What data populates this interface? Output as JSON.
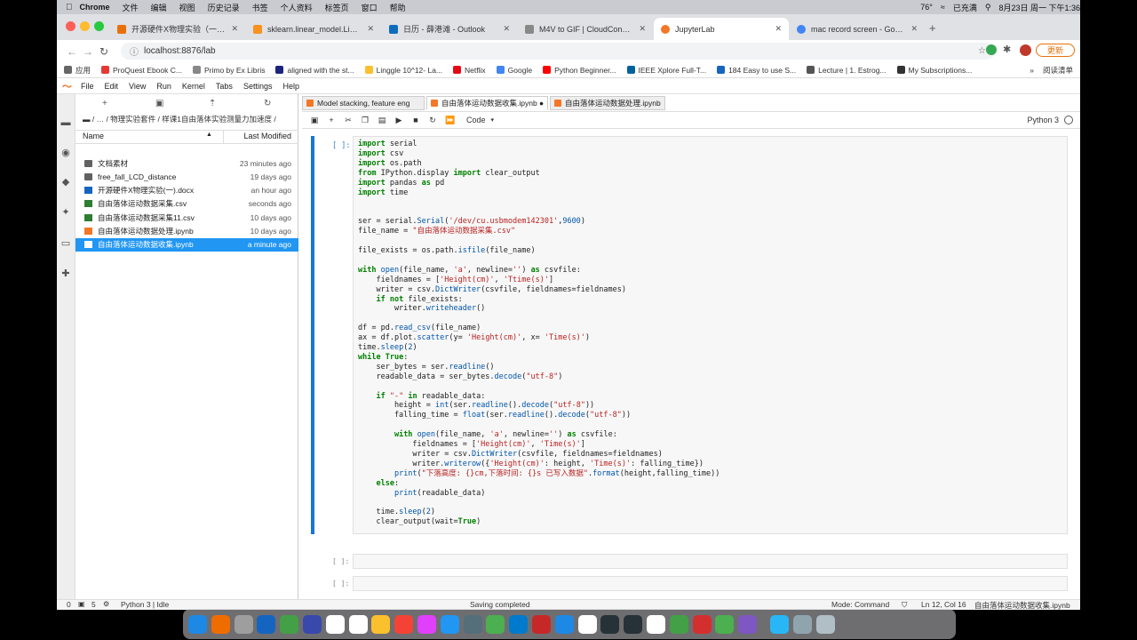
{
  "menubar": {
    "app": "Chrome",
    "items": [
      "文件",
      "编辑",
      "视图",
      "历史记录",
      "书签",
      "个人资料",
      "标签页",
      "窗口",
      "帮助"
    ],
    "status": [
      "76°",
      "已充满",
      "8月23日 周一 下午1:36"
    ]
  },
  "tabs": [
    {
      "title": "开源硬件X物理实验（一）- 自由",
      "color": "#e8710a"
    },
    {
      "title": "sklearn.linear_model.LinearRe",
      "color": "#f7931e"
    },
    {
      "title": "日历 - 薛港滩 - Outlook",
      "color": "#0f6cbd"
    },
    {
      "title": "M4V to GIF | CloudConvert",
      "color": "#888888"
    },
    {
      "title": "JupyterLab",
      "color": "#f37726"
    },
    {
      "title": "mac record screen - Google 搜",
      "color": "#4285f4"
    }
  ],
  "address": {
    "url": "localhost:8876/lab",
    "update_label": "更新"
  },
  "bookmarks": [
    {
      "label": "应用",
      "color": "#666666"
    },
    {
      "label": "ProQuest Ebook C...",
      "color": "#e53935"
    },
    {
      "label": "Primo by Ex Libris",
      "color": "#888888"
    },
    {
      "label": "aligned with the st...",
      "color": "#1a237e"
    },
    {
      "label": "Linggle 10^12- La...",
      "color": "#fbc02d"
    },
    {
      "label": "Netflix",
      "color": "#e50914"
    },
    {
      "label": "Google",
      "color": "#4285f4"
    },
    {
      "label": "Python Beginner...",
      "color": "#ff0000"
    },
    {
      "label": "IEEE Xplore Full-T...",
      "color": "#00629b"
    },
    {
      "label": "184 Easy to use S...",
      "color": "#1565c0"
    },
    {
      "label": "Lecture | 1. Estrog...",
      "color": "#555555"
    },
    {
      "label": "My Subscriptions...",
      "color": "#333333"
    }
  ],
  "reading_list": "阅读清单",
  "jupyter_menu": [
    "File",
    "Edit",
    "View",
    "Run",
    "Kernel",
    "Tabs",
    "Settings",
    "Help"
  ],
  "filebrowser": {
    "breadcrumb": "/ … / 物理实验套件 / 样课1自由落体实验测量力加速度 /",
    "col_name": "Name",
    "col_modified": "Last Modified",
    "files": [
      {
        "name": "文档素材",
        "modified": "23 minutes ago",
        "type": "folder"
      },
      {
        "name": "free_fall_LCD_distance",
        "modified": "19 days ago",
        "type": "folder"
      },
      {
        "name": "开源硬件X物理实验(一).docx",
        "modified": "an hour ago",
        "type": "doc"
      },
      {
        "name": "自由落体运动数据采集.csv",
        "modified": "seconds ago",
        "type": "csv"
      },
      {
        "name": "自由落体运动数据采集11.csv",
        "modified": "10 days ago",
        "type": "csv"
      },
      {
        "name": "自由落体运动数据处理.ipynb",
        "modified": "10 days ago",
        "type": "nb"
      },
      {
        "name": "自由落体运动数据收集.ipynb",
        "modified": "a minute ago",
        "type": "nb",
        "selected": true
      }
    ]
  },
  "notebook_tabs": [
    {
      "title": "Model stacking, feature eng"
    },
    {
      "title": "自由落体运动数据收集.ipynb ●"
    },
    {
      "title": "自由落体运动数据处理.ipynb"
    }
  ],
  "toolbar": {
    "cell_type": "Code",
    "kernel": "Python 3"
  },
  "cell": {
    "prompt": "[ ]:"
  },
  "empty_prompts": [
    "[ ]:",
    "[ ]:"
  ],
  "status": {
    "left1": "0",
    "left2": "5",
    "kernel": "Python 3 | Idle",
    "center": "Saving completed",
    "mode": "Mode: Command",
    "position": "Ln 12, Col 16",
    "file": "自由落体运动数据收集.ipynb"
  }
}
